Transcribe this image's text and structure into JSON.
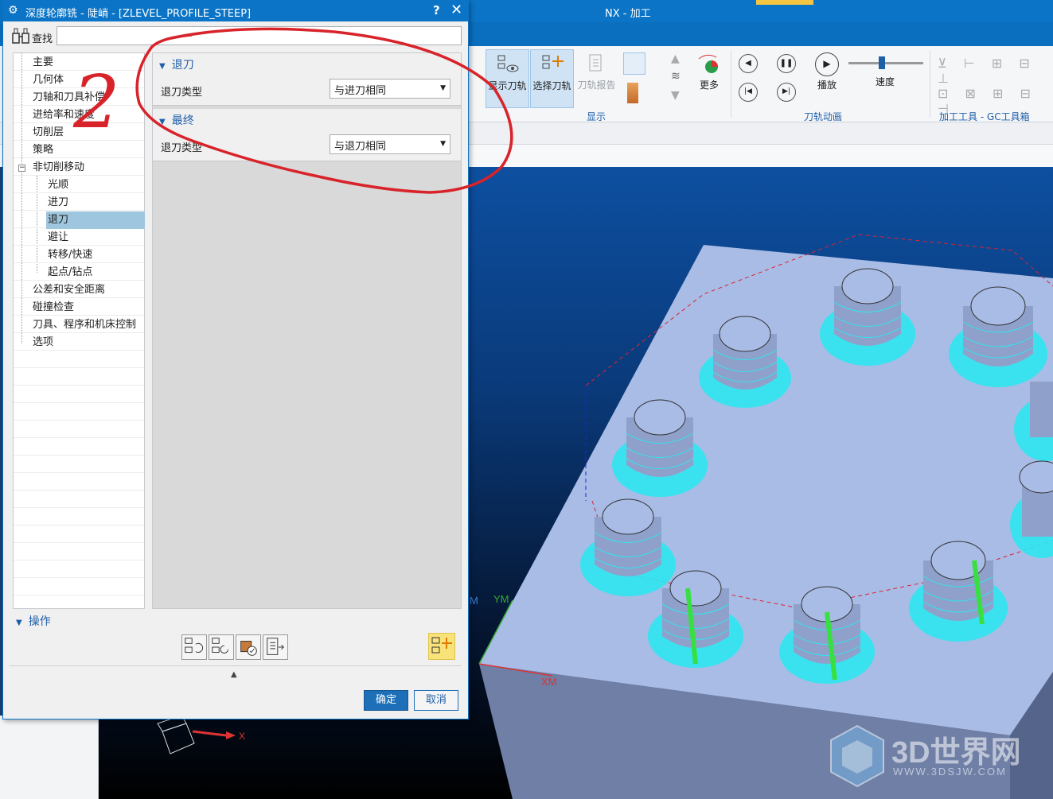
{
  "nx": {
    "title": "NX - 加工",
    "ribbon": {
      "display_tools": {
        "show_toolpath": "显示刀轨",
        "select_toolpath": "选择刀轨",
        "toolpath_report": "刀轨报告",
        "more": "更多",
        "group_label": "显示"
      },
      "animation": {
        "play": "播放",
        "speed": "速度",
        "group_label": "刀轨动画"
      },
      "process_tools": {
        "group_label": "加工工具 - GC工具箱"
      }
    },
    "viewport": {
      "axis_ym": "YM",
      "axis_xm": "XM",
      "axis_m": "M",
      "triad_x": "X"
    }
  },
  "dialog": {
    "title": "深度轮廓铣 - 陡峭 - [ZLEVEL_PROFILE_STEEP]",
    "help": "?",
    "close": "✕",
    "find_label": "查找",
    "find_value": "",
    "tree": [
      {
        "label": "主要"
      },
      {
        "label": "几何体"
      },
      {
        "label": "刀轴和刀具补偿"
      },
      {
        "label": "进给率和速度"
      },
      {
        "label": "切削层"
      },
      {
        "label": "策略"
      },
      {
        "label": "非切削移动"
      },
      {
        "label": "光顺"
      },
      {
        "label": "进刀"
      },
      {
        "label": "退刀"
      },
      {
        "label": "避让"
      },
      {
        "label": "转移/快速"
      },
      {
        "label": "起点/钻点"
      },
      {
        "label": "公差和安全距离"
      },
      {
        "label": "碰撞检查"
      },
      {
        "label": "刀具、程序和机床控制"
      },
      {
        "label": "选项"
      }
    ],
    "retract_group": {
      "title": "退刀",
      "field_label": "退刀类型",
      "value": "与进刀相同"
    },
    "final_group": {
      "title": "最终",
      "field_label": "退刀类型",
      "value": "与退刀相同"
    },
    "operations": {
      "title": "操作"
    },
    "ok": "确定",
    "cancel": "取消"
  },
  "annotation": {
    "handwritten_number": "2"
  },
  "watermark": {
    "text": "3D世界网",
    "url": "WWW.3DSJW.COM"
  },
  "colors": {
    "accent": "#0b74c6",
    "selected_tree": "#9ec6de",
    "annotation_red": "#d8232a",
    "toolpath_cyan": "#2ee6f0",
    "part_top": "#a9bce6"
  }
}
